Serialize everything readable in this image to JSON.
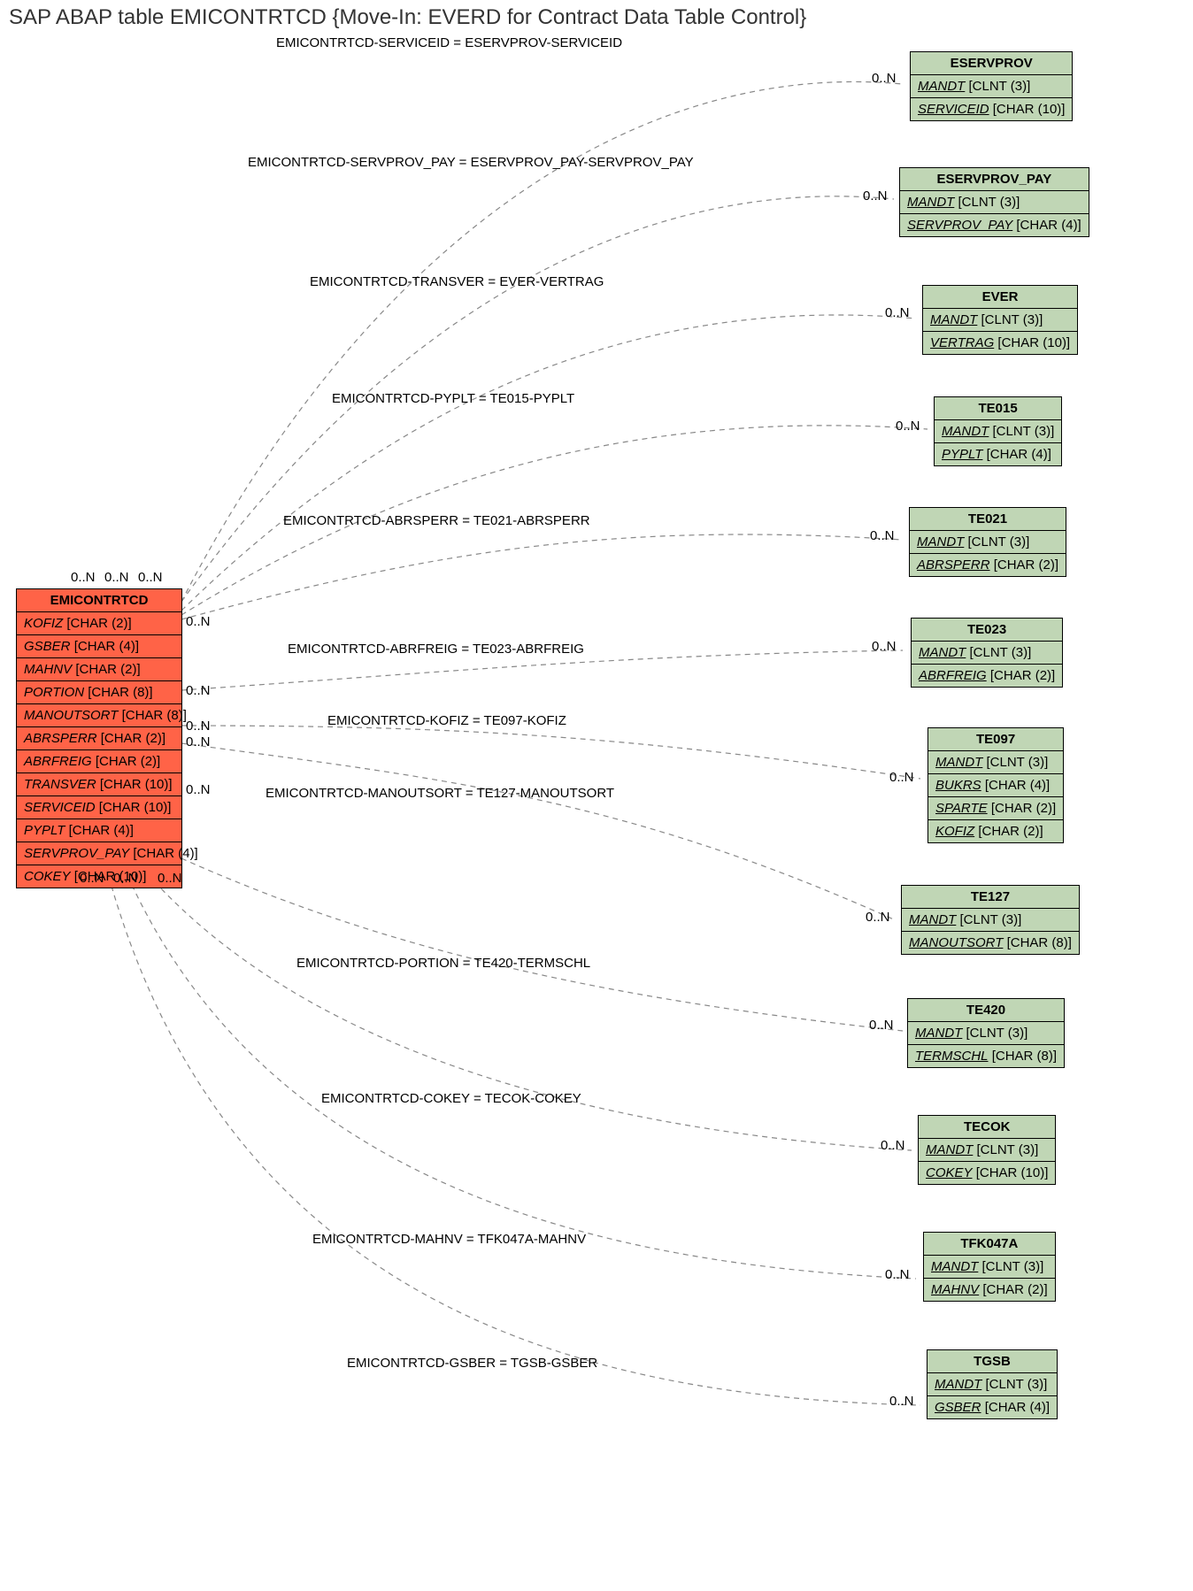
{
  "title": "SAP ABAP table EMICONTRTCD {Move-In: EVERD for Contract Data Table Control}",
  "main_table": {
    "name": "EMICONTRTCD",
    "fields": [
      {
        "fname": "KOFIZ",
        "type": "[CHAR (2)]"
      },
      {
        "fname": "GSBER",
        "type": "[CHAR (4)]"
      },
      {
        "fname": "MAHNV",
        "type": "[CHAR (2)]"
      },
      {
        "fname": "PORTION",
        "type": "[CHAR (8)]"
      },
      {
        "fname": "MANOUTSORT",
        "type": "[CHAR (8)]"
      },
      {
        "fname": "ABRSPERR",
        "type": "[CHAR (2)]"
      },
      {
        "fname": "ABRFREIG",
        "type": "[CHAR (2)]"
      },
      {
        "fname": "TRANSVER",
        "type": "[CHAR (10)]"
      },
      {
        "fname": "SERVICEID",
        "type": "[CHAR (10)]"
      },
      {
        "fname": "PYPLT",
        "type": "[CHAR (4)]"
      },
      {
        "fname": "SERVPROV_PAY",
        "type": "[CHAR (4)]"
      },
      {
        "fname": "COKEY",
        "type": "[CHAR (10)]"
      }
    ]
  },
  "ref_tables": [
    {
      "name": "ESERVPROV",
      "fields": [
        {
          "fname": "MANDT",
          "type": "[CLNT (3)]",
          "ul": true
        },
        {
          "fname": "SERVICEID",
          "type": "[CHAR (10)]",
          "ul": true
        }
      ]
    },
    {
      "name": "ESERVPROV_PAY",
      "fields": [
        {
          "fname": "MANDT",
          "type": "[CLNT (3)]",
          "ul": true
        },
        {
          "fname": "SERVPROV_PAY",
          "type": "[CHAR (4)]",
          "ul": true
        }
      ]
    },
    {
      "name": "EVER",
      "fields": [
        {
          "fname": "MANDT",
          "type": "[CLNT (3)]",
          "ul": true
        },
        {
          "fname": "VERTRAG",
          "type": "[CHAR (10)]",
          "ul": true
        }
      ]
    },
    {
      "name": "TE015",
      "fields": [
        {
          "fname": "MANDT",
          "type": "[CLNT (3)]",
          "ul": true
        },
        {
          "fname": "PYPLT",
          "type": "[CHAR (4)]",
          "ul": true
        }
      ]
    },
    {
      "name": "TE021",
      "fields": [
        {
          "fname": "MANDT",
          "type": "[CLNT (3)]",
          "ul": true
        },
        {
          "fname": "ABRSPERR",
          "type": "[CHAR (2)]",
          "ul": true
        }
      ]
    },
    {
      "name": "TE023",
      "fields": [
        {
          "fname": "MANDT",
          "type": "[CLNT (3)]",
          "ul": true
        },
        {
          "fname": "ABRFREIG",
          "type": "[CHAR (2)]",
          "ul": true
        }
      ]
    },
    {
      "name": "TE097",
      "fields": [
        {
          "fname": "MANDT",
          "type": "[CLNT (3)]",
          "ul": true
        },
        {
          "fname": "BUKRS",
          "type": "[CHAR (4)]",
          "ul": true
        },
        {
          "fname": "SPARTE",
          "type": "[CHAR (2)]",
          "ul": true
        },
        {
          "fname": "KOFIZ",
          "type": "[CHAR (2)]",
          "ul": true
        }
      ]
    },
    {
      "name": "TE127",
      "fields": [
        {
          "fname": "MANDT",
          "type": "[CLNT (3)]",
          "ul": true
        },
        {
          "fname": "MANOUTSORT",
          "type": "[CHAR (8)]",
          "ul": true
        }
      ]
    },
    {
      "name": "TE420",
      "fields": [
        {
          "fname": "MANDT",
          "type": "[CLNT (3)]",
          "ul": true
        },
        {
          "fname": "TERMSCHL",
          "type": "[CHAR (8)]",
          "ul": true
        }
      ]
    },
    {
      "name": "TECOK",
      "fields": [
        {
          "fname": "MANDT",
          "type": "[CLNT (3)]",
          "ul": true
        },
        {
          "fname": "COKEY",
          "type": "[CHAR (10)]",
          "ul": true
        }
      ]
    },
    {
      "name": "TFK047A",
      "fields": [
        {
          "fname": "MANDT",
          "type": "[CLNT (3)]",
          "ul": true
        },
        {
          "fname": "MAHNV",
          "type": "[CHAR (2)]",
          "ul": true
        }
      ]
    },
    {
      "name": "TGSB",
      "fields": [
        {
          "fname": "MANDT",
          "type": "[CLNT (3)]",
          "ul": true
        },
        {
          "fname": "GSBER",
          "type": "[CHAR (4)]",
          "ul": true
        }
      ]
    }
  ],
  "relations": [
    {
      "label": "EMICONTRTCD-SERVICEID = ESERVPROV-SERVICEID"
    },
    {
      "label": "EMICONTRTCD-SERVPROV_PAY = ESERVPROV_PAY-SERVPROV_PAY"
    },
    {
      "label": "EMICONTRTCD-TRANSVER = EVER-VERTRAG"
    },
    {
      "label": "EMICONTRTCD-PYPLT = TE015-PYPLT"
    },
    {
      "label": "EMICONTRTCD-ABRSPERR = TE021-ABRSPERR"
    },
    {
      "label": "EMICONTRTCD-ABRFREIG = TE023-ABRFREIG"
    },
    {
      "label": "EMICONTRTCD-KOFIZ = TE097-KOFIZ"
    },
    {
      "label": "EMICONTRTCD-MANOUTSORT = TE127-MANOUTSORT"
    },
    {
      "label": "EMICONTRTCD-PORTION = TE420-TERMSCHL"
    },
    {
      "label": "EMICONTRTCD-COKEY = TECOK-COKEY"
    },
    {
      "label": "EMICONTRTCD-MAHNV = TFK047A-MAHNV"
    },
    {
      "label": "EMICONTRTCD-GSBER = TGSB-GSBER"
    }
  ],
  "cardinality": "0..N",
  "main_cards_top": [
    "0..N",
    "0..N",
    "0..N"
  ],
  "main_cards_right": [
    "0..N",
    "0..N",
    "0..N",
    "0..N",
    "0..N"
  ],
  "main_cards_bottom": [
    "0..N",
    "0..N",
    "0..N"
  ]
}
